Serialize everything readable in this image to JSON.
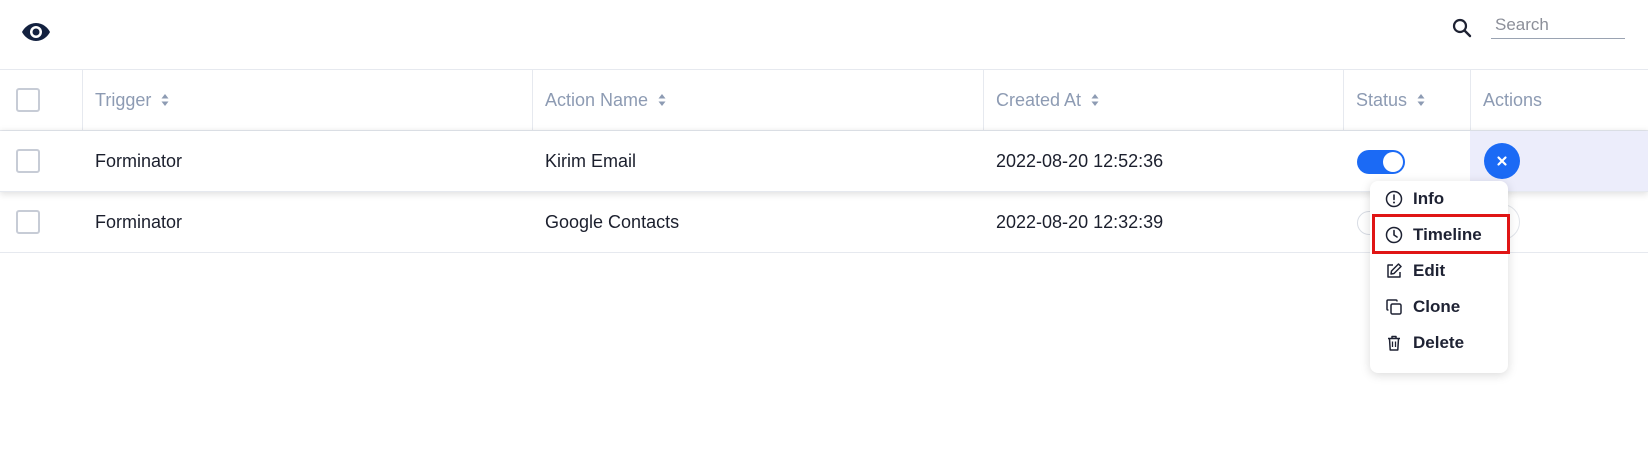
{
  "search": {
    "placeholder": "Search",
    "value": ""
  },
  "table": {
    "columns": [
      {
        "label": "Trigger",
        "sortable": true
      },
      {
        "label": "Action Name",
        "sortable": true
      },
      {
        "label": "Created At",
        "sortable": true
      },
      {
        "label": "Status",
        "sortable": true
      },
      {
        "label": "Actions",
        "sortable": false
      }
    ],
    "rows": [
      {
        "trigger": "Forminator",
        "action_name": "Kirim Email",
        "created_at": "2022-08-20 12:52:36",
        "status": "on"
      },
      {
        "trigger": "Forminator",
        "action_name": "Google Contacts",
        "created_at": "2022-08-20 12:32:39",
        "status": "off"
      }
    ]
  },
  "menu": {
    "items": [
      {
        "label": "Info",
        "icon": "info-icon"
      },
      {
        "label": "Timeline",
        "icon": "clock-icon"
      },
      {
        "label": "Edit",
        "icon": "edit-icon"
      },
      {
        "label": "Clone",
        "icon": "clone-icon"
      },
      {
        "label": "Delete",
        "icon": "trash-icon"
      }
    ],
    "highlighted": "Timeline"
  },
  "colors": {
    "accent": "#1b6af5",
    "header_text": "#8d9bb3",
    "highlight": "#e01515",
    "active_actions_bg": "#ecedfb"
  },
  "icons": {
    "visibility": "eye-icon",
    "search": "search-icon",
    "sort": "sort-icon",
    "close": "close-icon"
  }
}
